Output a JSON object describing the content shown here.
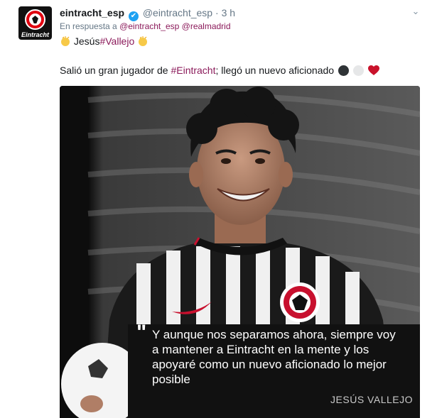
{
  "tweet": {
    "name": "eintracht_esp",
    "handle": "@eintracht_esp",
    "separator": "·",
    "time": "3 h",
    "avatar_text": "Eintracht",
    "reply_prefix": "En respuesta a",
    "reply_to": [
      "@eintracht_esp",
      "@realmadrid"
    ],
    "line1_text": "Jesús",
    "line1_hashtag": "#Vallejo",
    "line2_before": "Salió un gran jugador de",
    "line2_hashtag": "#Eintracht",
    "line2_after": "; llegó un nuevo aficionado",
    "icons": [
      "verified-badge-icon",
      "chevron-down-icon",
      "clapping-hands-icon",
      "black-circle-icon",
      "white-circle-icon",
      "red-heart-icon"
    ],
    "colors": {
      "link": "#8b1a5a",
      "verified": "#1da1f2",
      "heart": "#c9122b",
      "muted": "#657786"
    }
  },
  "media": {
    "quote_mark": "\"",
    "quote": "Y aunque nos separamos ahora, siempre voy a mantener a Eintracht en la mente y los apoyaré como un nuevo aficionado lo mejor posible",
    "signature": "JESÚS VALLEJO"
  }
}
